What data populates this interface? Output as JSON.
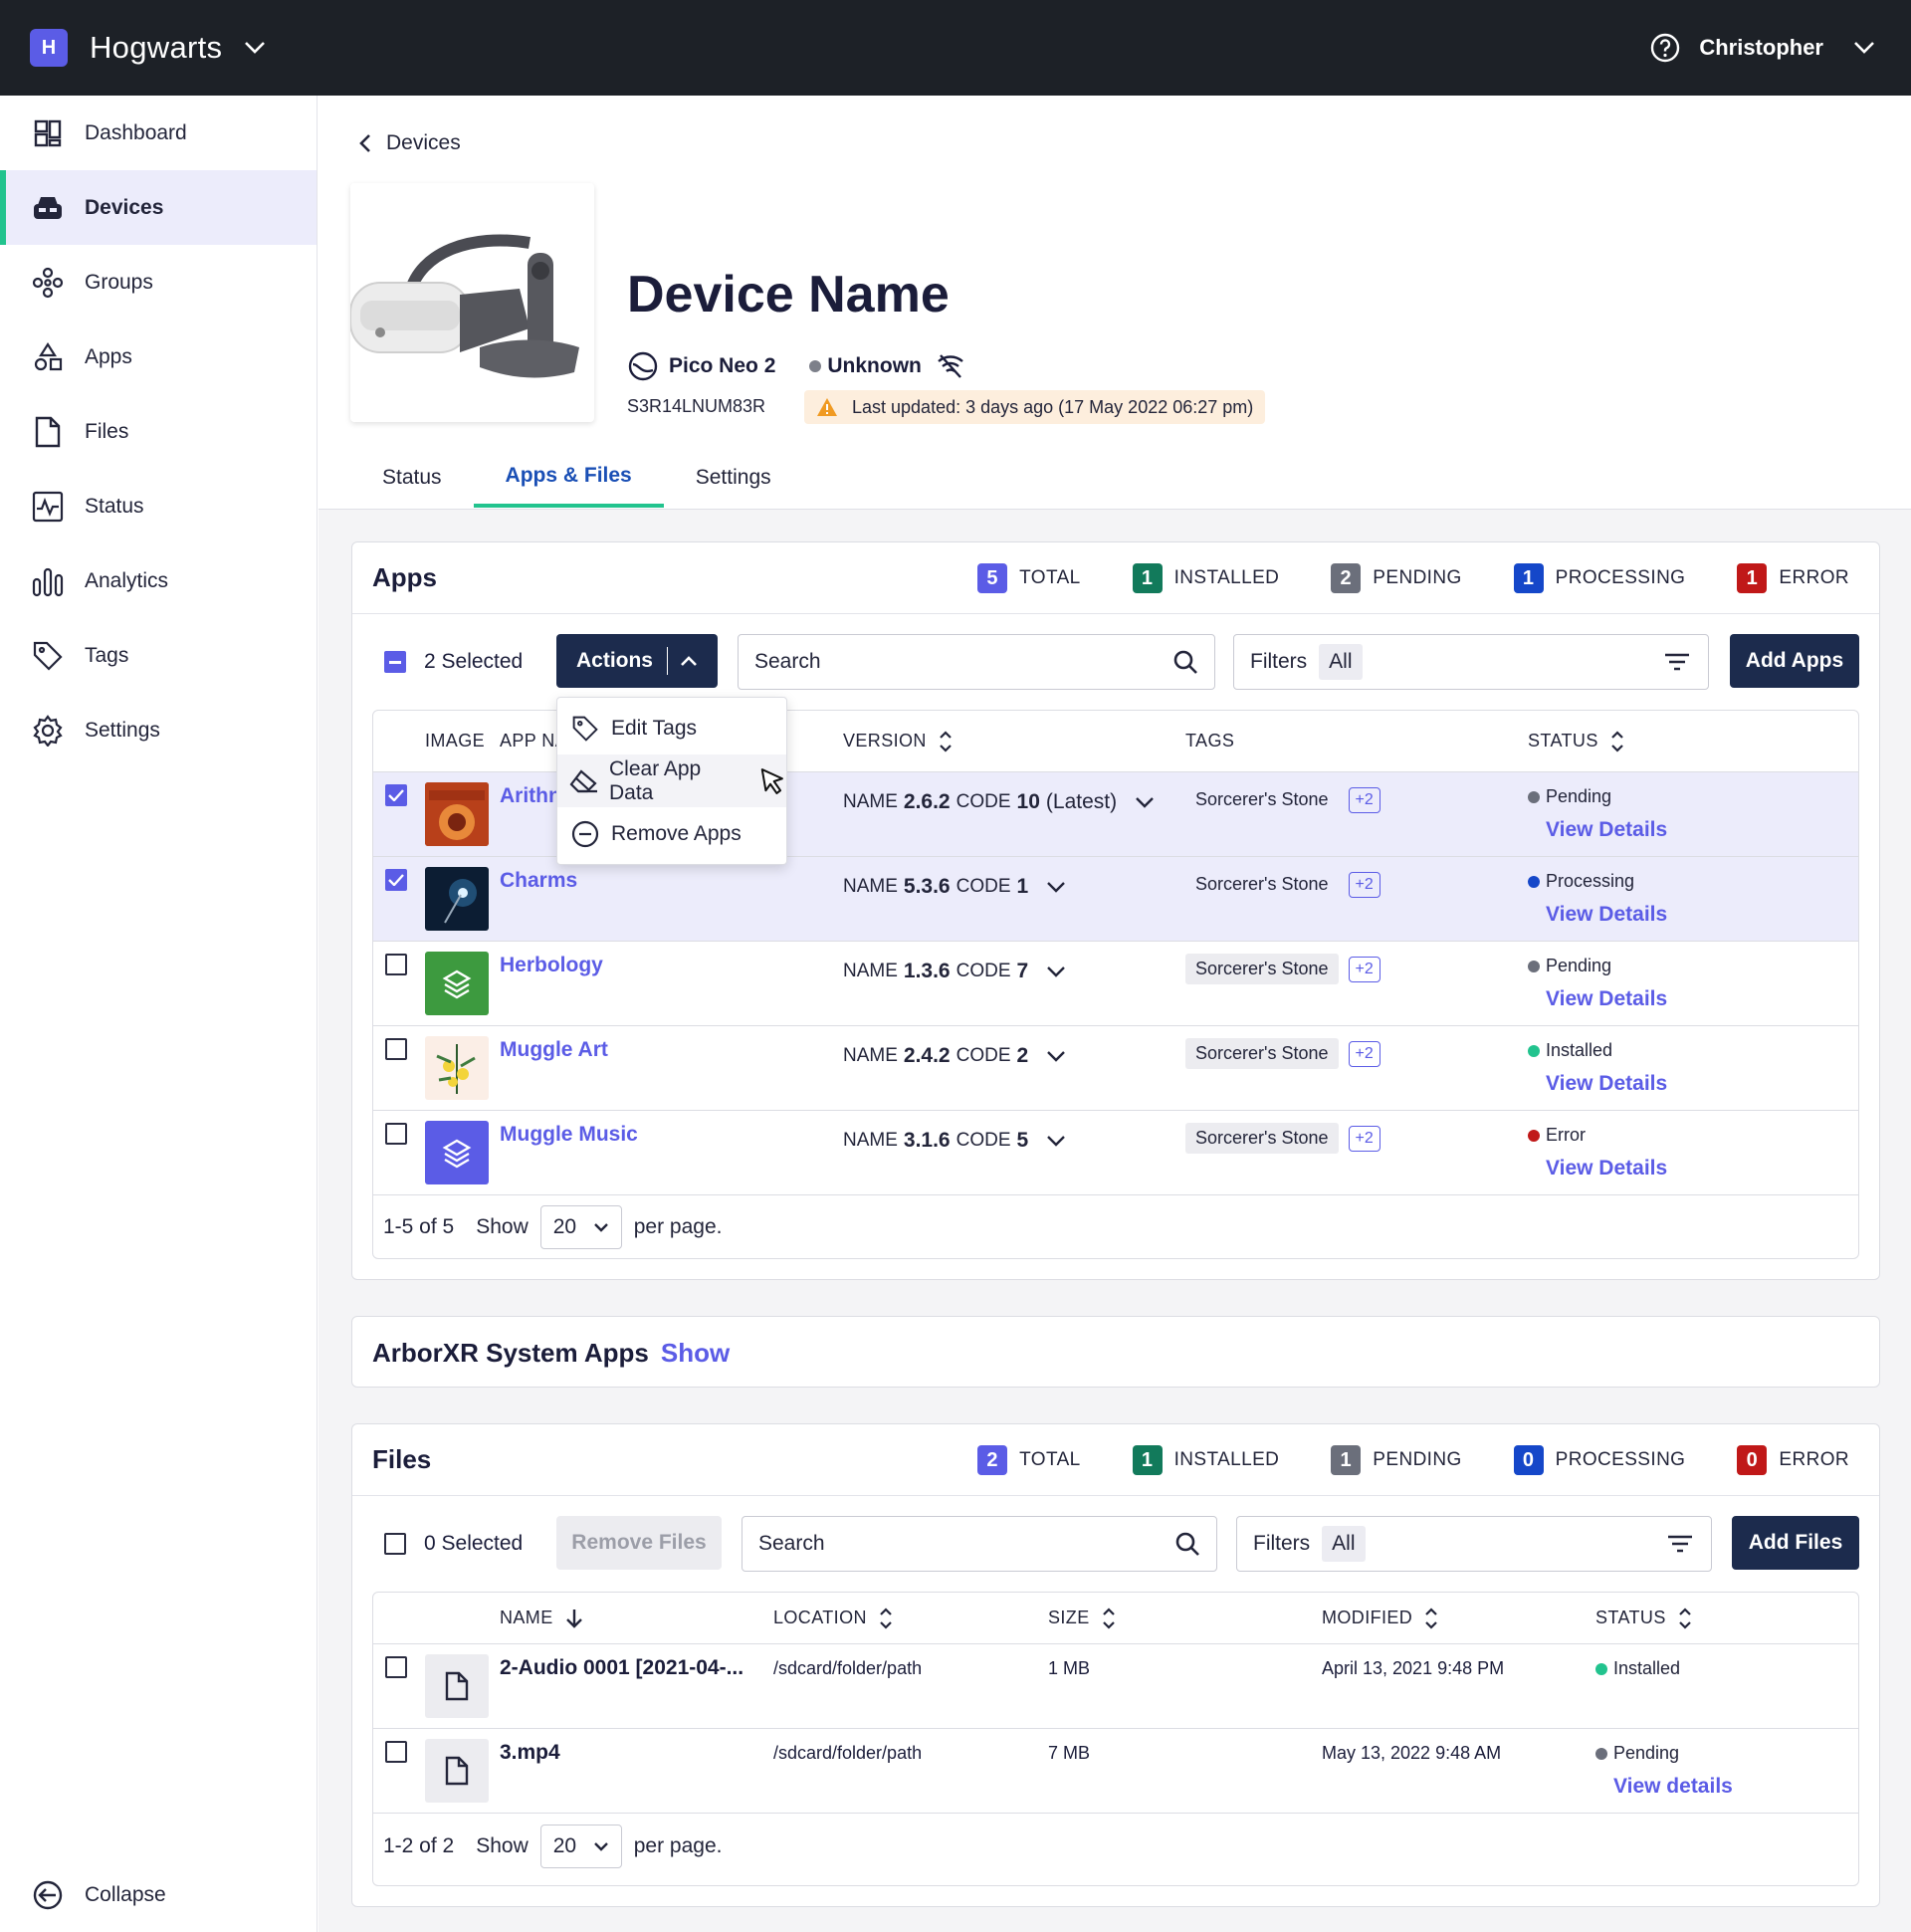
{
  "topbar": {
    "org_initial": "H",
    "org_name": "Hogwarts",
    "user_name": "Christopher"
  },
  "sidebar": {
    "items": [
      {
        "label": "Dashboard",
        "icon": "dashboard-icon"
      },
      {
        "label": "Devices",
        "icon": "headset-icon",
        "active": true
      },
      {
        "label": "Groups",
        "icon": "groups-icon"
      },
      {
        "label": "Apps",
        "icon": "apps-icon"
      },
      {
        "label": "Files",
        "icon": "file-icon"
      },
      {
        "label": "Status",
        "icon": "pulse-icon"
      },
      {
        "label": "Analytics",
        "icon": "bar-chart-icon"
      },
      {
        "label": "Tags",
        "icon": "tag-icon"
      },
      {
        "label": "Settings",
        "icon": "gear-icon"
      }
    ],
    "collapse_label": "Collapse"
  },
  "breadcrumb": {
    "label": "Devices"
  },
  "device": {
    "name": "Device Name",
    "model": "Pico Neo 2",
    "connection": "Unknown",
    "serial": "S3R14LNUM83R",
    "last_updated": "Last updated: 3 days ago (17 May 2022 06:27 pm)"
  },
  "tabs": [
    {
      "label": "Status"
    },
    {
      "label": "Apps & Files",
      "active": true
    },
    {
      "label": "Settings"
    }
  ],
  "apps": {
    "title": "Apps",
    "counts": [
      {
        "value": "5",
        "label": "TOTAL",
        "color": "#5b5ce6"
      },
      {
        "value": "1",
        "label": "INSTALLED",
        "color": "#127a5b"
      },
      {
        "value": "2",
        "label": "PENDING",
        "color": "#6b6f7b"
      },
      {
        "value": "1",
        "label": "PROCESSING",
        "color": "#1547c9"
      },
      {
        "value": "1",
        "label": "ERROR",
        "color": "#c01818"
      }
    ],
    "selected_label": "2 Selected",
    "actions_label": "Actions",
    "search_placeholder": "Search",
    "filters_label": "Filters",
    "filters_value": "All",
    "add_label": "Add Apps",
    "columns": {
      "image": "IMAGE",
      "name": "APP NA",
      "version": "VERSION",
      "tags": "TAGS",
      "status": "STATUS"
    },
    "rows": [
      {
        "name": "Arithn",
        "checked": true,
        "ver_name": "2.6.2",
        "ver_code": "10",
        "latest": "(Latest)",
        "tag": "Sorcerer's Stone",
        "more": "+2",
        "status": "Pending",
        "status_color": "#6b6f7b",
        "view": "View Details"
      },
      {
        "name": "Charms",
        "checked": true,
        "ver_name": "5.3.6",
        "ver_code": "1",
        "latest": "",
        "tag": "Sorcerer's Stone",
        "more": "+2",
        "status": "Processing",
        "status_color": "#1547c9",
        "view": "View Details"
      },
      {
        "name": "Herbology",
        "checked": false,
        "ver_name": "1.3.6",
        "ver_code": "7",
        "latest": "",
        "tag": "Sorcerer's Stone",
        "more": "+2",
        "status": "Pending",
        "status_color": "#6b6f7b",
        "view": "View Details"
      },
      {
        "name": "Muggle Art",
        "checked": false,
        "ver_name": "2.4.2",
        "ver_code": "2",
        "latest": "",
        "tag": "Sorcerer's Stone",
        "more": "+2",
        "status": "Installed",
        "status_color": "#22c38e",
        "view": "View Details"
      },
      {
        "name": "Muggle Music",
        "checked": false,
        "ver_name": "3.1.6",
        "ver_code": "5",
        "latest": "",
        "tag": "Sorcerer's Stone",
        "more": "+2",
        "status": "Error",
        "status_color": "#c01818",
        "view": "View Details"
      }
    ],
    "version_name_label": "NAME",
    "version_code_label": "CODE",
    "pager": {
      "range": "1-5 of 5",
      "show": "Show",
      "per_page": "20",
      "suffix": "per page."
    },
    "thumb_text": "ARITHMANCY 101"
  },
  "actions_menu": {
    "items": [
      "Edit Tags",
      "Clear App Data",
      "Remove Apps"
    ]
  },
  "system_apps": {
    "title": "ArborXR System Apps",
    "show_label": "Show"
  },
  "files": {
    "title": "Files",
    "counts": [
      {
        "value": "2",
        "label": "TOTAL",
        "color": "#5b5ce6"
      },
      {
        "value": "1",
        "label": "INSTALLED",
        "color": "#127a5b"
      },
      {
        "value": "1",
        "label": "PENDING",
        "color": "#6b6f7b"
      },
      {
        "value": "0",
        "label": "PROCESSING",
        "color": "#1547c9"
      },
      {
        "value": "0",
        "label": "ERROR",
        "color": "#c01818"
      }
    ],
    "selected_label": "0 Selected",
    "remove_label": "Remove Files",
    "search_placeholder": "Search",
    "filters_label": "Filters",
    "filters_value": "All",
    "add_label": "Add Files",
    "columns": {
      "name": "NAME",
      "location": "LOCATION",
      "size": "SIZE",
      "modified": "MODIFIED",
      "status": "STATUS"
    },
    "rows": [
      {
        "name": "2-Audio 0001 [2021-04-...",
        "location": "/sdcard/folder/path",
        "size": "1 MB",
        "modified": "April 13, 2021 9:48 PM",
        "status": "Installed",
        "status_color": "#22c38e",
        "view": ""
      },
      {
        "name": "3.mp4",
        "location": "/sdcard/folder/path",
        "size": "7 MB",
        "modified": "May 13, 2022 9:48 AM",
        "status": "Pending",
        "status_color": "#6b6f7b",
        "view": "View details"
      }
    ],
    "pager": {
      "range": "1-2 of 2",
      "show": "Show",
      "per_page": "20",
      "suffix": "per page."
    }
  }
}
